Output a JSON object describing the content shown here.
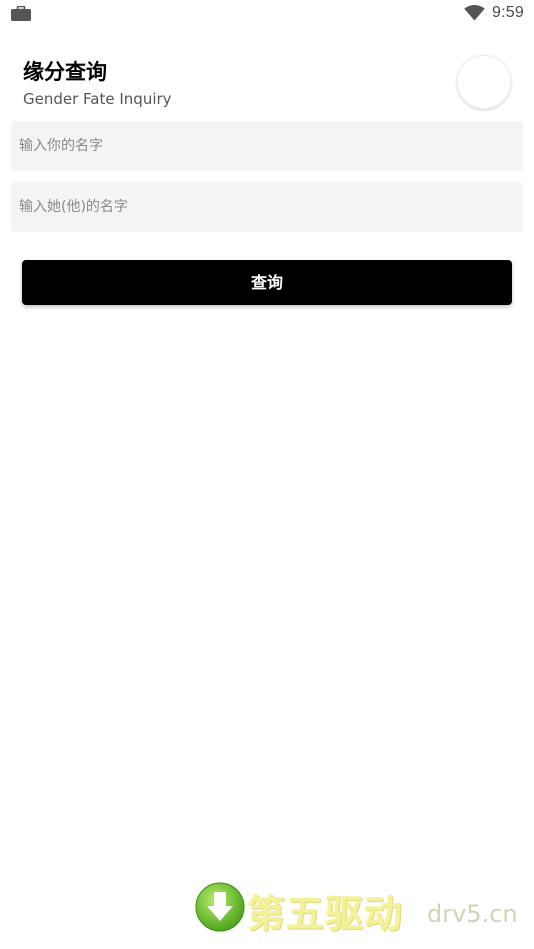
{
  "status_bar": {
    "time": "9:59",
    "left_icon": "briefcase-icon",
    "wifi_icon": "wifi-icon"
  },
  "header": {
    "title": "缘分查询",
    "subtitle": "Gender Fate Inquiry"
  },
  "form": {
    "name_placeholder": "输入你的名字",
    "partner_placeholder": "输入她(他)的名字",
    "name_value": "",
    "partner_value": "",
    "submit_label": "查询"
  },
  "watermark": {
    "text_cn": "第五驱动",
    "text_url": "drv5.cn"
  },
  "colors": {
    "button_bg": "#000000",
    "button_text": "#ffffff",
    "field_bg": "#f4f4f4",
    "watermark_green": "#7ec636",
    "watermark_yellow": "#f2f08a"
  }
}
